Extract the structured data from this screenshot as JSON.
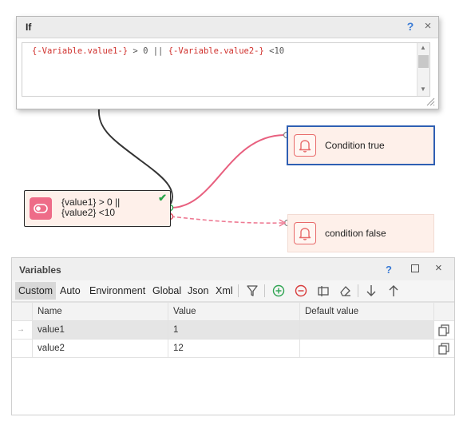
{
  "if_window": {
    "title": "If",
    "help_label": "?",
    "close_label": "×",
    "code_tokens": {
      "var1": "{-Variable.value1-}",
      "op1": " > 0 || ",
      "var2": "{-Variable.value2-}",
      "op2": " <10"
    }
  },
  "flow": {
    "if_node": {
      "line1": "{value1} > 0 ||",
      "line2": "{value2} <10",
      "check": "✔"
    },
    "true_node": {
      "label": "Condition true"
    },
    "false_node": {
      "label": "condition false"
    },
    "colors": {
      "true_link": "#e8607f",
      "false_link": "#ee7a93",
      "if_input_link": "#333333"
    }
  },
  "variables": {
    "title": "Variables",
    "help_label": "?",
    "close_label": "×",
    "tabs": [
      "Custom",
      "Auto",
      "Environment",
      "Global",
      "Json",
      "Xml"
    ],
    "active_tab": "Custom",
    "toolbar_icons": [
      "filter-icon",
      "add-icon",
      "remove-icon",
      "clear-values-icon",
      "eraser-icon",
      "move-down-icon",
      "move-up-icon"
    ],
    "columns": {
      "name": "Name",
      "value": "Value",
      "default": "Default value"
    },
    "rows": [
      {
        "indicator": "→",
        "name": "value1",
        "value": "1",
        "default": ""
      },
      {
        "indicator": "",
        "name": "value2",
        "value": "12",
        "default": ""
      }
    ]
  }
}
